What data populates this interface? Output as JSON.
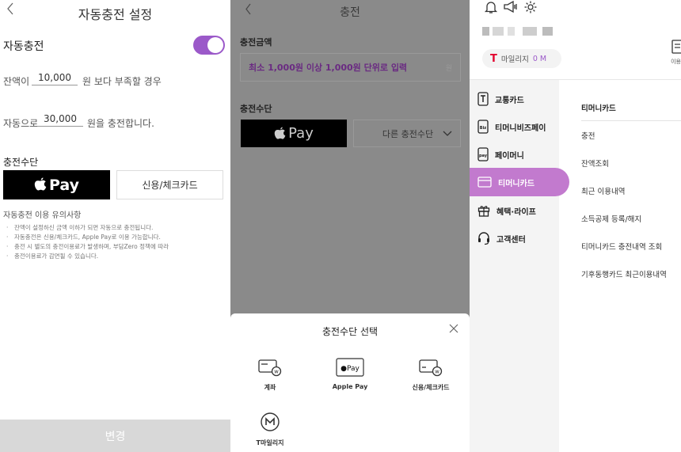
{
  "screen1": {
    "back_icon": "chevron-left-icon",
    "title": "자동충전 설정",
    "autocharge_label": "자동충전",
    "toggle_state": "on",
    "balance_prefix": "잔액이",
    "balance_value": "10,000",
    "balance_suffix": "원 보다 부족할 경우",
    "auto_prefix": "자동으로",
    "auto_value": "30,000",
    "auto_suffix": "원을 충전합니다.",
    "payment_label": "충전수단",
    "applepay_label": "Pay",
    "credit_label": "신용/체크카드",
    "notes_title": "자동충전 이용 유의사항",
    "notes": [
      "잔액이 설정하신 금액 이하가 되면 자동으로 충전됩니다.",
      "자동충전은 신용/체크카드, Apple Pay로 이용 가능합니다.",
      "충전 시 별도의 충전이용료가 발생하며, 부담Zero 정책에 따라",
      "충전이용료가 감면될 수 있습니다."
    ],
    "submit_label": "변경",
    "colors": {
      "accent": "#9b59c9",
      "disabled": "#d8d8d8"
    }
  },
  "screen2": {
    "back_icon": "chevron-left-icon",
    "title": "충전",
    "amount_label": "충전금액",
    "amount_placeholder": "최소 1,000원 이상 1,000원 단위로 입력",
    "amount_unit": "원",
    "method_label": "충전수단",
    "applepay_label": "Pay",
    "other_label": "다른 충전수단",
    "sheet": {
      "title": "충전수단 선택",
      "close_icon": "close-icon",
      "options": [
        {
          "label": "계좌",
          "icon": "bank-card-icon"
        },
        {
          "label": "Apple Pay",
          "icon": "apple-pay-icon"
        },
        {
          "label": "신용/체크카드",
          "icon": "credit-card-icon"
        },
        {
          "label": "T마일리지",
          "icon": "t-mileage-icon"
        }
      ]
    },
    "colors": {
      "accent": "#6a2a82"
    }
  },
  "screen3": {
    "top_icons": [
      "bell-icon",
      "megaphone-icon",
      "gear-icon"
    ],
    "mileage_label": "마일리지",
    "mileage_value": "0 M",
    "right_label": "이용",
    "nav": [
      {
        "label": "교통카드",
        "icon": "transit-card-icon"
      },
      {
        "label": "티머니비즈페이",
        "icon": "bizpay-icon"
      },
      {
        "label": "페이머니",
        "icon": "paymoney-icon"
      },
      {
        "label": "티머니카드",
        "icon": "card-icon",
        "active": true
      },
      {
        "label": "혜택·라이프",
        "icon": "gift-icon"
      },
      {
        "label": "고객센터",
        "icon": "headset-icon"
      }
    ],
    "submenu": [
      "티머니카드",
      "충전",
      "잔액조회",
      "최근 이용내역",
      "소득공제 등록/해지",
      "티머니카드 충전내역 조회",
      "기후동행카드 최근이용내역"
    ],
    "colors": {
      "active": "#c27ace",
      "brand_t": "#e3062f"
    }
  }
}
